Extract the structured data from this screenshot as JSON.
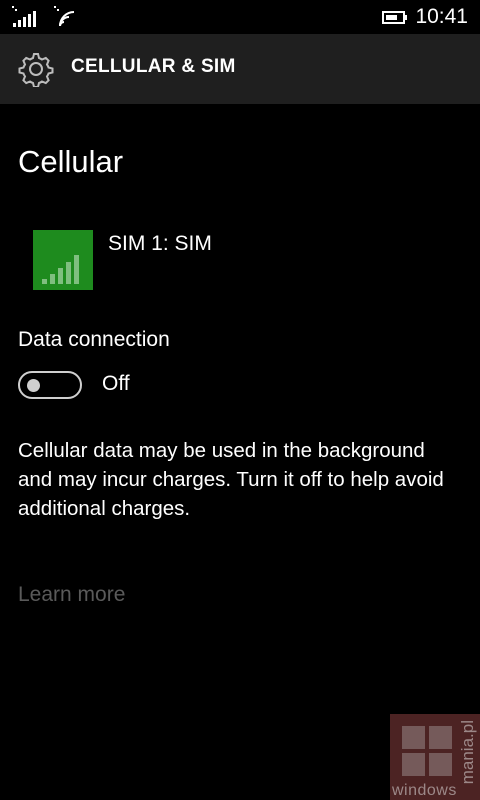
{
  "status_bar": {
    "time": "10:41",
    "signal_icon": "signal-strength-icon",
    "wifi_icon": "wifi-icon",
    "battery_icon": "battery-icon"
  },
  "header": {
    "title": "CELLULAR & SIM",
    "icon": "gear-icon"
  },
  "section": {
    "title": "Cellular"
  },
  "sim": {
    "label": "SIM 1: SIM",
    "tile_color": "#1e8b1e",
    "icon": "signal-bars-icon"
  },
  "data_connection": {
    "label": "Data connection",
    "state_label": "Off",
    "enabled": false
  },
  "description": "Cellular data may be used in the background and may incur charges. Turn it off to help avoid additional charges.",
  "learn_more": "Learn more",
  "watermark": {
    "text": "windowsmania.pl",
    "text_bottom": "windows",
    "text_side": "mania.pl"
  }
}
